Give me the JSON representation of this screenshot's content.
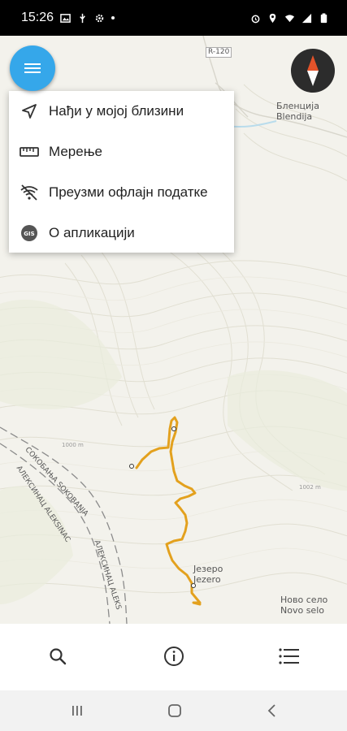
{
  "status_bar": {
    "time": "15:26"
  },
  "map": {
    "labels": {
      "r120": "R-120",
      "blendija_cyr": "Бленција",
      "blendija_lat": "Blendija",
      "jezero_cyr": "Језеро",
      "jezero_lat": "Jezero",
      "novo_selo_cyr": "Ново село",
      "novo_selo_lat": "Novo selo",
      "sokobanja_cyr": "СОКОБАЊА",
      "sokobanja_lat": "SOKOBANJA",
      "aleksinac1_cyr": "АЛЕКСИНАЦ",
      "aleksinac1_lat": "ALEKSINAC",
      "aleksinac2_cyr": "АЛЕКСИНАЦ",
      "aleksinac2_lat": "ALEKS",
      "alt_1000": "1000 m",
      "alt_1002": "1002 m"
    }
  },
  "menu": {
    "items": [
      {
        "label": "Нађи у мојој близини",
        "icon": "navigation-arrow-icon"
      },
      {
        "label": "Мерење",
        "icon": "ruler-icon"
      },
      {
        "label": "Преузми офлајн податке",
        "icon": "wifi-off-icon"
      },
      {
        "label": "О апликацији",
        "icon": "gis-logo-icon"
      }
    ]
  },
  "bottom_nav": {
    "items": [
      {
        "icon": "search-icon"
      },
      {
        "icon": "info-icon"
      },
      {
        "icon": "list-icon"
      }
    ]
  },
  "colors": {
    "fab": "#35a7ea",
    "track": "#e3a11e",
    "compass_red": "#e4532a"
  }
}
